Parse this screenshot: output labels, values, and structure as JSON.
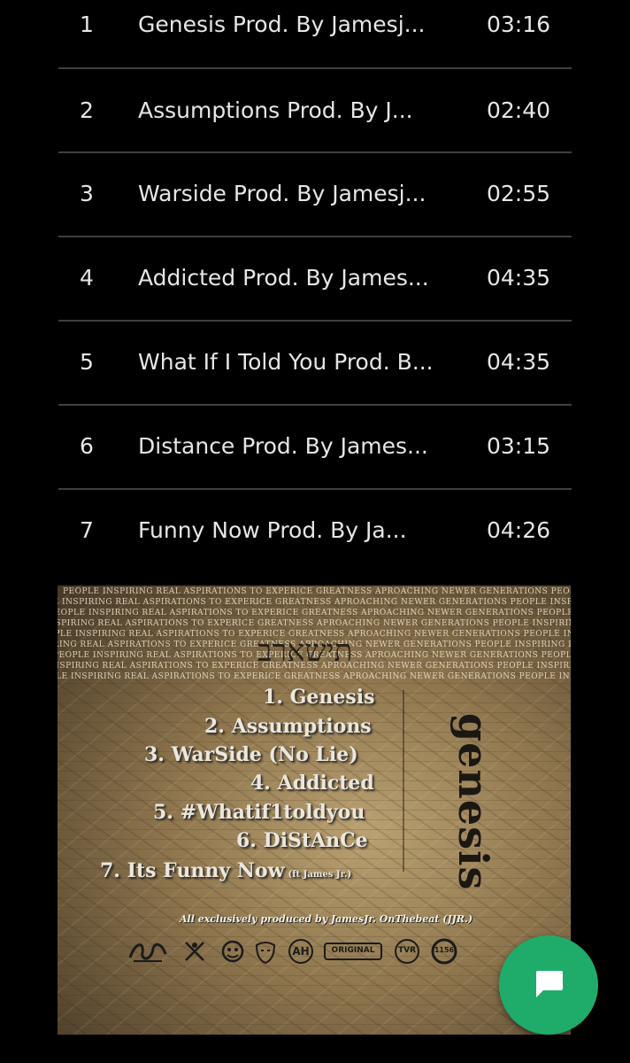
{
  "tracklist": {
    "tracks": [
      {
        "number": "1",
        "title": "Genesis Prod. By Jamesj...",
        "duration": "03:16"
      },
      {
        "number": "2",
        "title": "Assumptions Prod. By J...",
        "duration": "02:40"
      },
      {
        "number": "3",
        "title": "Warside Prod. By Jamesj...",
        "duration": "02:55"
      },
      {
        "number": "4",
        "title": "Addicted Prod. By James...",
        "duration": "04:35"
      },
      {
        "number": "5",
        "title": "What If I Told You Prod. B...",
        "duration": "04:35"
      },
      {
        "number": "6",
        "title": "Distance Prod. By James...",
        "duration": "03:15"
      },
      {
        "number": "7",
        "title": "Funny Now Prod. By Ja...",
        "duration": "04:26"
      }
    ]
  },
  "cover": {
    "banner_text": "PEOPLE INSPIRING REAL ASPIRATIONS TO EXPERICE GREATNESS APROACHING NEWER GENERATIONS PEOPLE INSPIRING REAL ASPIRATIONS TO EXPERICE GREATNESS APROACHING NEWER GENERATIONS",
    "hebrew_title": "תישארב",
    "vertical_title": "genesis",
    "songs": [
      {
        "label": "1. Genesis",
        "feat": ""
      },
      {
        "label": "2. Assumptions",
        "feat": ""
      },
      {
        "label": "3. WarSide (No Lie)",
        "feat": ""
      },
      {
        "label": "4. Addicted",
        "feat": ""
      },
      {
        "label": "5. #Whatif1toldyou",
        "feat": ""
      },
      {
        "label": "6. DiStAnCe",
        "feat": ""
      },
      {
        "label": "7. Its Funny Now",
        "feat": "(ft James Jr.)"
      }
    ],
    "credits": "All exclusively produced by JamesJr. OnThebeat (JJR.)",
    "logos": {
      "ah": "AH",
      "original": "ORIGINAL",
      "tvr": "TVR",
      "num": "1156"
    }
  },
  "chat_fab": {
    "icon": "chat-bubble-icon",
    "color": "#1fac6a"
  }
}
